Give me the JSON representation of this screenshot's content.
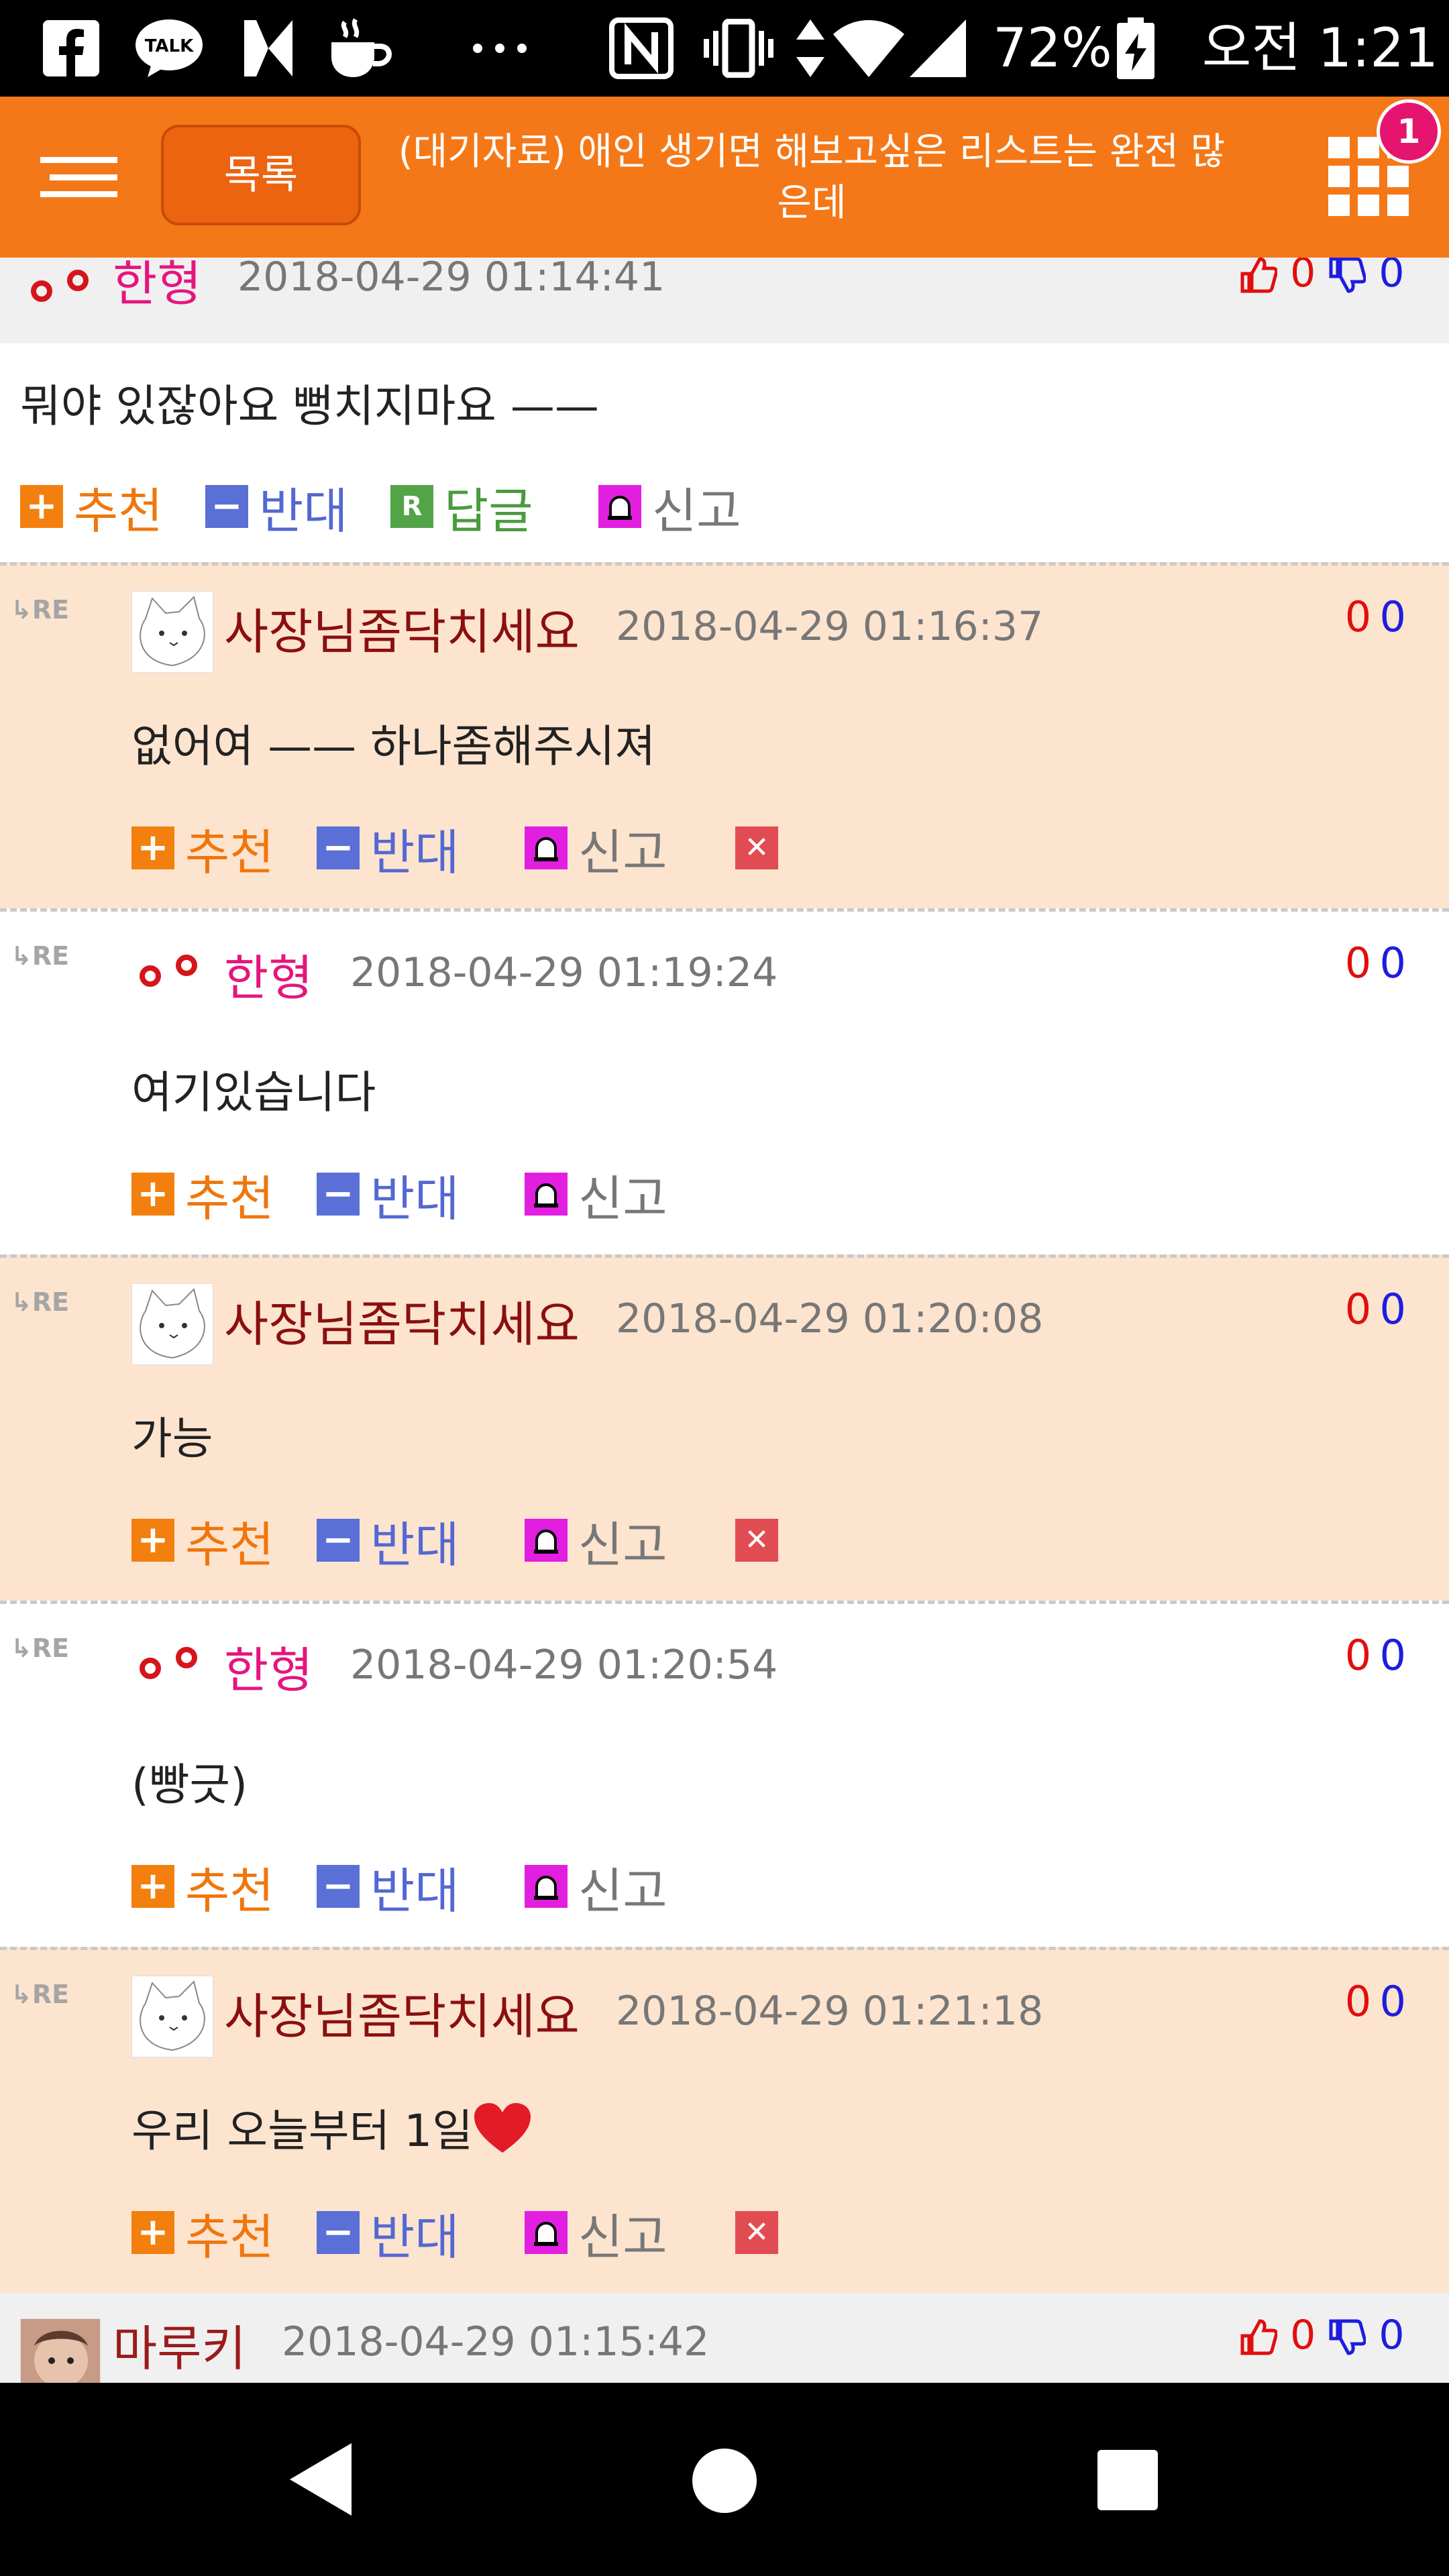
{
  "status_bar": {
    "battery": "72%",
    "time": "오전 1:21",
    "icons": [
      "facebook-icon",
      "kakaotalk-icon",
      "app-icon",
      "coffee-icon",
      "more-icon",
      "nfc-icon",
      "vibrate-icon",
      "data-arrows-icon",
      "wifi-icon",
      "signal-icon",
      "battery-charging-icon"
    ]
  },
  "header": {
    "list_button": "목록",
    "title": "(대기자료) 애인 생기면 해보고싶은 리스트는 완전 많은데",
    "notification_count": "1"
  },
  "comments": [
    {
      "nick": "한형",
      "date": "2018-04-29 01:14:41",
      "up": "0",
      "down": "0",
      "text": "뭐야 있잖아요 뻥치지마요 ——",
      "actions": {
        "recommend": "추천",
        "oppose": "반대",
        "reply": "답글",
        "report": "신고"
      }
    }
  ],
  "replies": [
    {
      "nick": "사장님좀닥치세요",
      "date": "2018-04-29 01:16:37",
      "up": "0",
      "down": "0",
      "text": "없어여 —— 하나좀해주시져"
    },
    {
      "nick": "한형",
      "date": "2018-04-29 01:19:24",
      "up": "0",
      "down": "0",
      "text": "여기있습니다"
    },
    {
      "nick": "사장님좀닥치세요",
      "date": "2018-04-29 01:20:08",
      "up": "0",
      "down": "0",
      "text": "가능"
    },
    {
      "nick": "한형",
      "date": "2018-04-29 01:20:54",
      "up": "0",
      "down": "0",
      "text": "(빵긋)"
    },
    {
      "nick": "사장님좀닥치세요",
      "date": "2018-04-29 01:21:18",
      "up": "0",
      "down": "0",
      "text": "우리 오늘부터 1일"
    }
  ],
  "labels": {
    "re": "RE",
    "recommend": "추천",
    "oppose": "반대",
    "report": "신고"
  },
  "next_comment": {
    "nick": "마루키",
    "date": "2018-04-29 01:15:42",
    "up": "0",
    "down": "0"
  },
  "colors": {
    "accent": "#f47818",
    "peach": "#fde4cf",
    "nick_pink": "#e5157e"
  }
}
